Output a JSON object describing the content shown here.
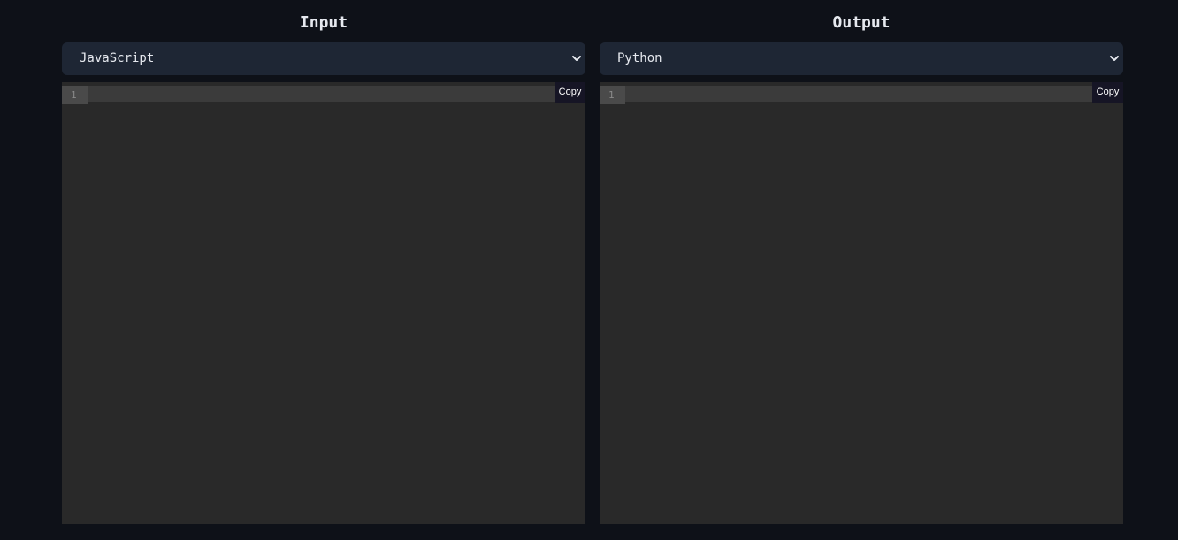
{
  "input": {
    "title": "Input",
    "language": "JavaScript",
    "line_numbers": [
      "1"
    ],
    "copy_label": "Copy"
  },
  "output": {
    "title": "Output",
    "language": "Python",
    "line_numbers": [
      "1"
    ],
    "copy_label": "Copy"
  },
  "icons": {
    "select_indicator": "chevron-down-icon"
  },
  "colors": {
    "background": "#0e1118",
    "select_background": "#1e2634",
    "editor_background": "#292929",
    "copy_button_background": "#161525",
    "text": "#e6e9ef"
  }
}
